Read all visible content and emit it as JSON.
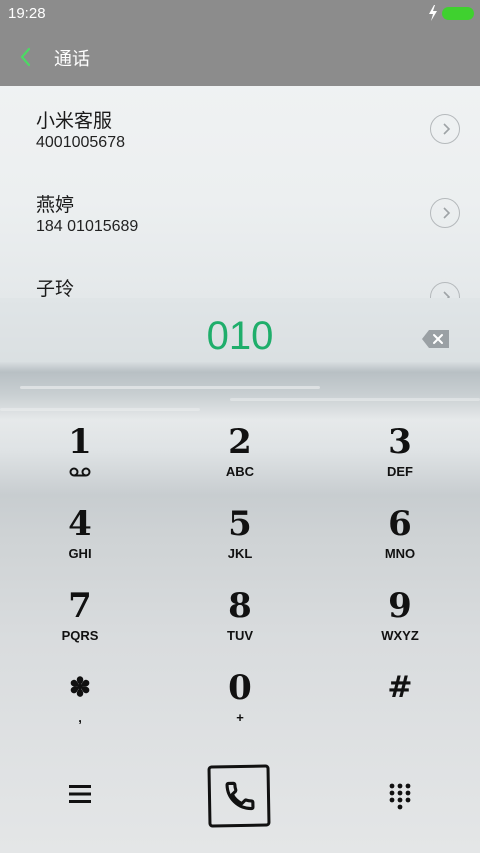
{
  "status_bar": {
    "time": "19:28"
  },
  "header": {
    "title": "通话"
  },
  "contacts": [
    {
      "name": "小米客服",
      "number": "4001005678"
    },
    {
      "name": "燕婷",
      "number": "184 01015689"
    },
    {
      "name": "子玲",
      "number": ""
    }
  ],
  "dialer": {
    "entered_number": "010"
  },
  "keypad": [
    {
      "digit": "1",
      "letters": ""
    },
    {
      "digit": "2",
      "letters": "ABC"
    },
    {
      "digit": "3",
      "letters": "DEF"
    },
    {
      "digit": "4",
      "letters": "GHI"
    },
    {
      "digit": "5",
      "letters": "JKL"
    },
    {
      "digit": "6",
      "letters": "MNO"
    },
    {
      "digit": "7",
      "letters": "PQRS"
    },
    {
      "digit": "8",
      "letters": "TUV"
    },
    {
      "digit": "9",
      "letters": "WXYZ"
    },
    {
      "digit": "✽",
      "letters": ","
    },
    {
      "digit": "0",
      "letters": "+"
    },
    {
      "digit": "#",
      "letters": ""
    }
  ],
  "colors": {
    "accent": "#1fae6b",
    "header": "#8c8c8c",
    "battery": "#3fd12f"
  },
  "icons": [
    "back-arrow-icon",
    "chevron-right-icon",
    "backspace-icon",
    "voicemail-icon",
    "menu-icon",
    "phone-icon",
    "dialpad-icon",
    "charging-bolt-icon",
    "battery-icon"
  ]
}
